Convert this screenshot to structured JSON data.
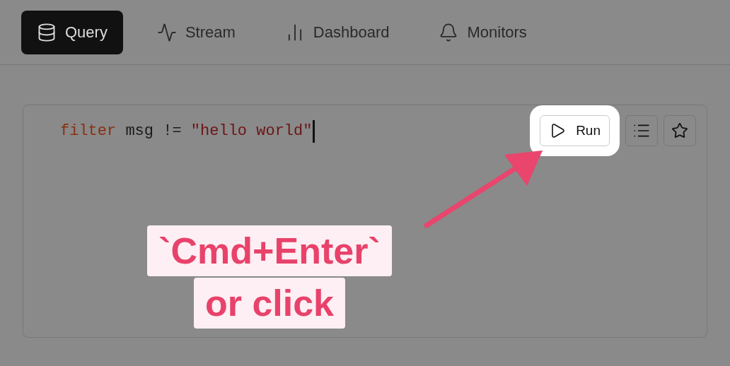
{
  "tabs": [
    {
      "label": "Query",
      "selected": true
    },
    {
      "label": "Stream",
      "selected": false
    },
    {
      "label": "Dashboard",
      "selected": false
    },
    {
      "label": "Monitors",
      "selected": false
    }
  ],
  "editor": {
    "code": [
      {
        "kind": "keyword",
        "text": "filter"
      },
      {
        "kind": "plain",
        "text": " msg != "
      },
      {
        "kind": "string",
        "text": "\"hello world\""
      }
    ],
    "run_button": {
      "label": "Run"
    }
  },
  "annotation": {
    "lines": [
      "`Cmd+Enter`",
      "or click"
    ]
  }
}
